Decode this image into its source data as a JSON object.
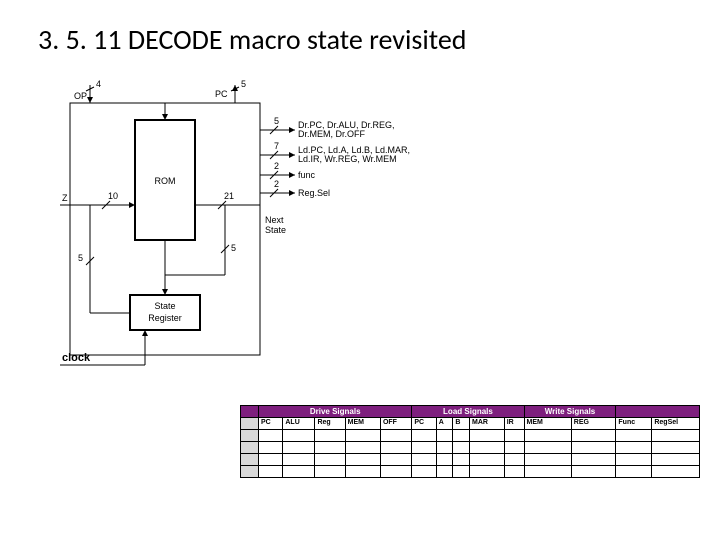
{
  "title": "3. 5. 11 DECODE macro state revisited",
  "diagram": {
    "rom": "ROM",
    "state_register": "State\nRegister",
    "clock": "clock",
    "next_state": "Next\nState",
    "op": "OP",
    "z": "Z",
    "slash4": "4",
    "slash10": "10",
    "slash21": "21",
    "slash5a": "5",
    "slash5b": "5",
    "slash5c": "5",
    "slash7": "7",
    "slash2a": "2",
    "slash2b": "2",
    "pc": "PC",
    "dr_group": "Dr.PC, Dr.ALU, Dr.REG,\nDr.MEM, Dr.OFF",
    "ld_group": "Ld.PC, Ld.A, Ld.B, Ld.MAR,\nLd.IR, Wr.REG, Wr.MEM",
    "func": "func",
    "regsel": "Reg.Sel"
  },
  "table": {
    "groups": {
      "drive": "Drive Signals",
      "load": "Load Signals",
      "write": "Write Signals"
    },
    "cols": [
      "PC",
      "ALU",
      "Reg",
      "MEM",
      "OFF",
      "PC",
      "A",
      "B",
      "MAR",
      "IR",
      "MEM",
      "REG",
      "Func",
      "RegSel"
    ]
  }
}
